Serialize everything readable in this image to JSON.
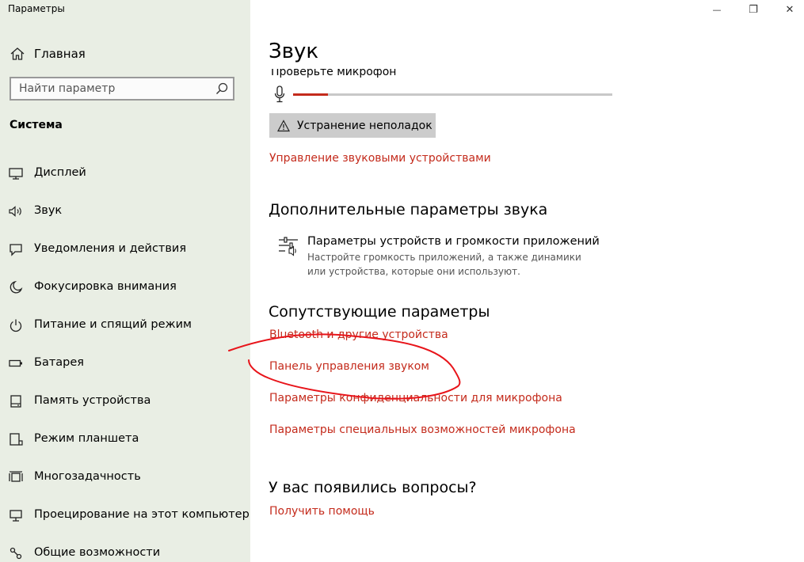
{
  "window": {
    "title": "Параметры",
    "minimize_glyph": "—",
    "maximize_glyph": "❐",
    "close_glyph": "✕"
  },
  "sidebar": {
    "home_label": "Главная",
    "search_placeholder": "Найти параметр",
    "section_title": "Система",
    "items": [
      {
        "label": "Дисплей",
        "icon": "display-icon"
      },
      {
        "label": "Звук",
        "icon": "speaker-icon"
      },
      {
        "label": "Уведомления и действия",
        "icon": "notification-icon"
      },
      {
        "label": "Фокусировка внимания",
        "icon": "moon-icon"
      },
      {
        "label": "Питание и спящий режим",
        "icon": "power-icon"
      },
      {
        "label": "Батарея",
        "icon": "battery-icon"
      },
      {
        "label": "Память устройства",
        "icon": "storage-icon"
      },
      {
        "label": "Режим планшета",
        "icon": "tablet-icon"
      },
      {
        "label": "Многозадачность",
        "icon": "multitasking-icon"
      },
      {
        "label": "Проецирование на этот компьютер",
        "icon": "projection-icon"
      },
      {
        "label": "Общие возможности",
        "icon": "shared-icon"
      }
    ]
  },
  "main": {
    "title": "Звук",
    "mic_label": "Проверьте микрофон",
    "mic_level": 0.11,
    "troubleshoot_label": "Устранение неполадок",
    "manage_devices_link": "Управление звуковыми устройствами",
    "advanced": {
      "heading": "Дополнительные параметры звука",
      "item_title": "Параметры устройств и громкости приложений",
      "item_desc": "Настройте громкость приложений, а также динамики или устройства, которые они используют."
    },
    "related": {
      "heading": "Сопутствующие параметры",
      "links": [
        "Bluetooth и другие устройства",
        "Панель управления звуком",
        "Параметры конфиденциальности для микрофона",
        "Параметры специальных возможностей микрофона"
      ]
    },
    "help": {
      "heading": "У вас появились вопросы?",
      "link": "Получить помощь"
    }
  },
  "colors": {
    "accent": "#c42b1c",
    "sidebar_bg": "#e9eee4",
    "annotation": "#e8141a"
  }
}
